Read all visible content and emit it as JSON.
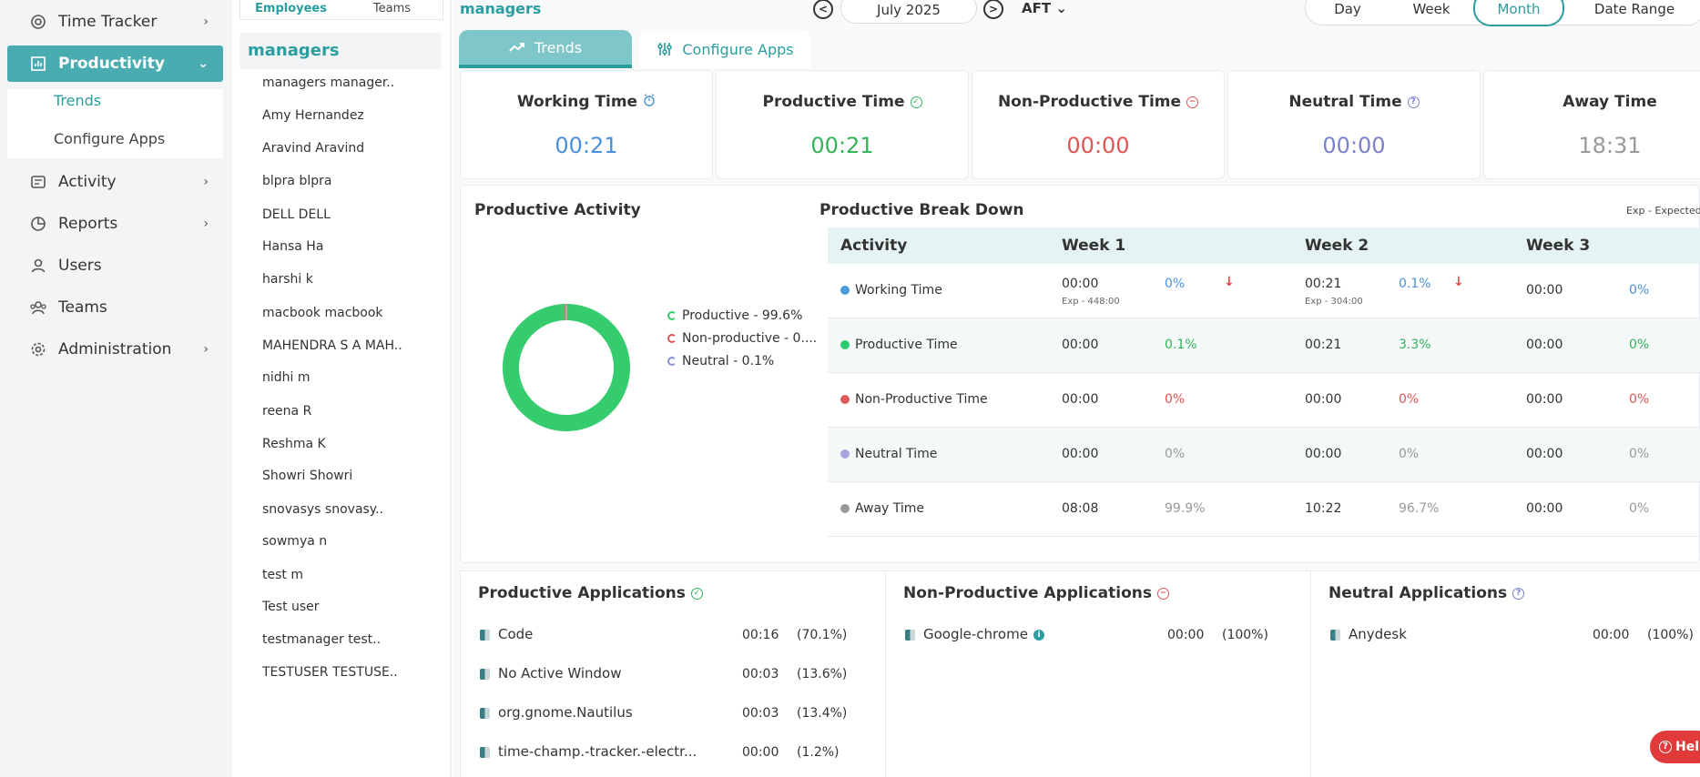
{
  "sidebar": {
    "items": [
      {
        "label": "Time Tracker",
        "icon": "time-tracker-icon"
      },
      {
        "label": "Productivity",
        "icon": "productivity-chart-icon"
      },
      {
        "label": "Activity",
        "icon": "activity-icon"
      },
      {
        "label": "Reports",
        "icon": "reports-pie-icon"
      },
      {
        "label": "Users",
        "icon": "user-icon"
      },
      {
        "label": "Teams",
        "icon": "teams-icon"
      },
      {
        "label": "Administration",
        "icon": "gear-icon"
      }
    ],
    "submenu": [
      "Trends",
      "Configure Apps"
    ]
  },
  "employees": {
    "tabs": [
      "Employees",
      "Teams"
    ],
    "group": "managers",
    "list": [
      "managers manager..",
      "Amy Hernandez",
      "Aravind Aravind",
      "blpra blpra",
      "DELL DELL",
      "Hansa Ha",
      "harshi k",
      "macbook macbook",
      "MAHENDRA S A MAH..",
      "nidhi m",
      "reena R",
      "Reshma K",
      "Showri Showri",
      "snovasys snovasy..",
      "sowmya n",
      "test m",
      "Test user",
      "testmanager test..",
      "TESTUSER TESTUSE.."
    ]
  },
  "header": {
    "title": "managers",
    "prev": "<",
    "next": ">",
    "date": "July 2025",
    "timezone": "AFT",
    "ranges": [
      "Day",
      "Week",
      "Month",
      "Date Range"
    ],
    "active_range": "Month"
  },
  "view_tabs": [
    "Trends",
    "Configure Apps"
  ],
  "kpis": [
    {
      "title": "Working Time",
      "value": "00:21",
      "color": "#4a90d9"
    },
    {
      "title": "Productive Time",
      "value": "00:21",
      "color": "#33b35a"
    },
    {
      "title": "Non-Productive Time",
      "value": "00:00",
      "color": "#e05555"
    },
    {
      "title": "Neutral Time",
      "value": "00:00",
      "color": "#7b82c9"
    },
    {
      "title": "Away Time",
      "value": "18:31",
      "color": "#999999"
    }
  ],
  "productive_activity": {
    "title": "Productive Activity",
    "legend": [
      "Productive - 99.6%",
      "Non-productive - 0....",
      "Neutral - 0.1%"
    ],
    "colors": {
      "productive": "#35cc6d",
      "non_productive": "#e05555",
      "neutral": "#8a90d6"
    }
  },
  "chart_data": {
    "type": "pie",
    "donut": true,
    "title": "Productive Activity",
    "labels": [
      "Productive",
      "Non-productive",
      "Neutral"
    ],
    "values": [
      99.6,
      0.3,
      0.1
    ]
  },
  "breakdown": {
    "title": "Productive Break Down",
    "note": "Exp - Expected Ho",
    "headers": [
      "Activity",
      "Week 1",
      "Week 2",
      "Week 3"
    ],
    "rows": [
      {
        "name": "Working Time",
        "dot": "#4a9ee0",
        "w1": "00:00",
        "w1p": "0%",
        "w1sub": "Exp - 448:00",
        "w2": "00:21",
        "w2p": "0.1%",
        "w2sub": "Exp - 304:00",
        "w3": "00:00",
        "w3p": "0%",
        "pcolor": "#4a90d9",
        "arrow": "↓"
      },
      {
        "name": "Productive Time",
        "dot": "#2ecc71",
        "w1": "00:00",
        "w1p": "0.1%",
        "w2": "00:21",
        "w2p": "3.3%",
        "w3": "00:00",
        "w3p": "0%",
        "pcolor": "#33b35a"
      },
      {
        "name": "Non-Productive Time",
        "dot": "#e05a5a",
        "w1": "00:00",
        "w1p": "0%",
        "w2": "00:00",
        "w2p": "0%",
        "w3": "00:00",
        "w3p": "0%",
        "pcolor": "#e05555"
      },
      {
        "name": "Neutral Time",
        "dot": "#a8a4dc",
        "w1": "00:00",
        "w1p": "0%",
        "w2": "00:00",
        "w2p": "0%",
        "w3": "00:00",
        "w3p": "0%",
        "pcolor": "#999999"
      },
      {
        "name": "Away Time",
        "dot": "#999999",
        "w1": "08:08",
        "w1p": "99.9%",
        "w2": "10:22",
        "w2p": "96.7%",
        "w3": "00:00",
        "w3p": "0%",
        "pcolor": "#999999"
      }
    ]
  },
  "apps": {
    "productive": {
      "title": "Productive Applications",
      "items": [
        {
          "name": "Code",
          "time": "00:16",
          "pct": "(70.1%)"
        },
        {
          "name": "No Active Window",
          "time": "00:03",
          "pct": "(13.6%)"
        },
        {
          "name": "org.gnome.Nautilus",
          "time": "00:03",
          "pct": "(13.4%)"
        },
        {
          "name": "time-champ.-tracker.-electr...",
          "time": "00:00",
          "pct": "(1.2%)"
        }
      ]
    },
    "non_productive": {
      "title": "Non-Productive Applications",
      "items": [
        {
          "name": "Google-chrome",
          "time": "00:00",
          "pct": "(100%)"
        }
      ]
    },
    "neutral": {
      "title": "Neutral Applications",
      "items": [
        {
          "name": "Anydesk",
          "time": "00:00",
          "pct": "(100%)"
        }
      ]
    }
  },
  "help_label": "Hel"
}
